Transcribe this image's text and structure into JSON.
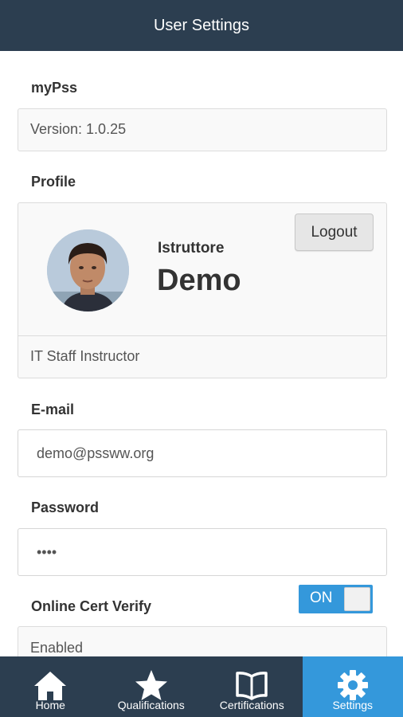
{
  "header": {
    "title": "User Settings"
  },
  "app_section": {
    "label": "myPss",
    "version": "Version: 1.0.25"
  },
  "profile": {
    "label": "Profile",
    "first_name": "Istruttore",
    "last_name": "Demo",
    "logout_label": "Logout",
    "role": "IT Staff Instructor"
  },
  "email": {
    "label": "E-mail",
    "value": "demo@pssww.org"
  },
  "password": {
    "label": "Password",
    "value": "demo"
  },
  "online_cert": {
    "label": "Online Cert Verify",
    "status": "Enabled",
    "toggle_label": "ON"
  },
  "tabs": [
    {
      "label": "Home",
      "icon": "home-icon"
    },
    {
      "label": "Qualifications",
      "icon": "star-icon"
    },
    {
      "label": "Certifications",
      "icon": "book-icon"
    },
    {
      "label": "Settings",
      "icon": "gear-icon",
      "active": true
    }
  ],
  "colors": {
    "header": "#2c3e50",
    "accent": "#3498db",
    "tabbar": "#2c3e50"
  }
}
